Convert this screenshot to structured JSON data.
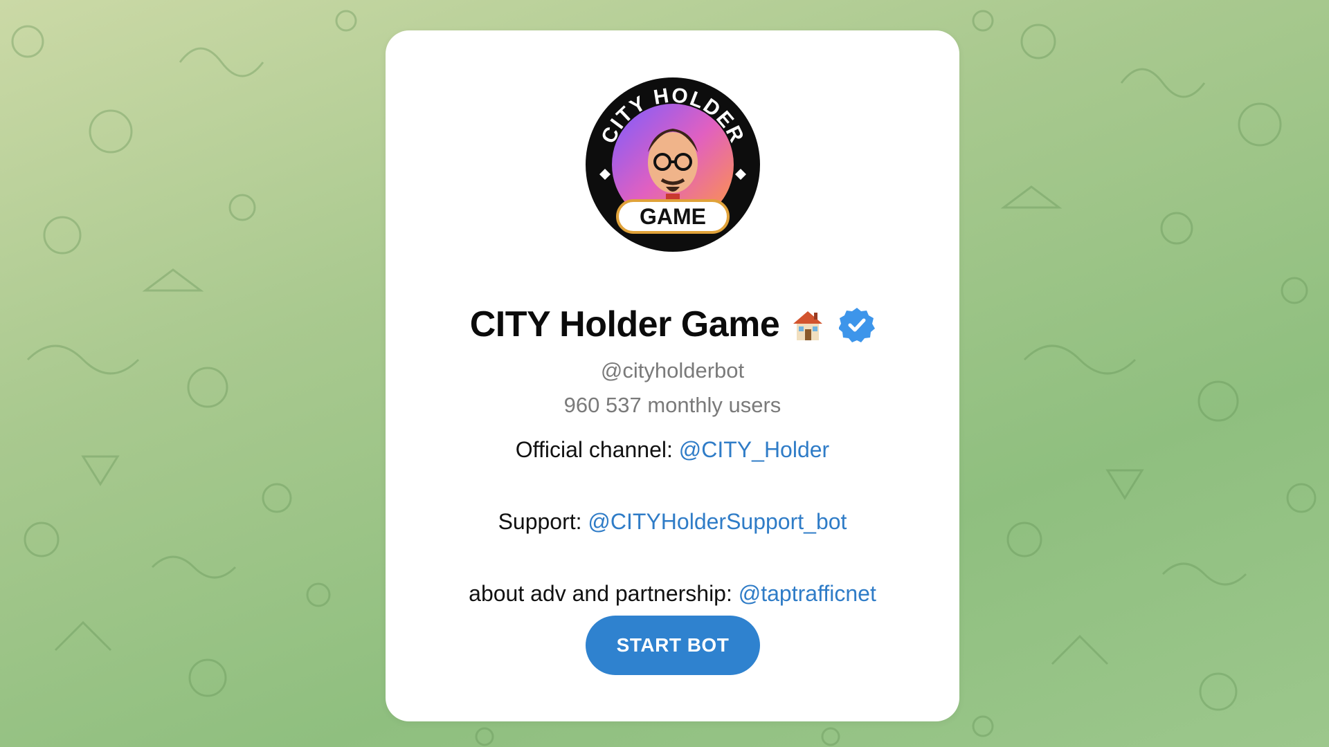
{
  "profile": {
    "title": "CITY Holder Game",
    "username": "@cityholderbot",
    "monthly_users": "960 537 monthly users",
    "avatar": {
      "ring_text": "CITY HOLDER",
      "banner_text": "GAME"
    },
    "icons": {
      "title_emoji": "house-icon",
      "badge": "verified-icon"
    }
  },
  "description": {
    "official_label": "Official channel: ",
    "official_link": "@CITY_Holder",
    "support_label": "Support: ",
    "support_link": "@CITYHolderSupport_bot",
    "adv_label": "about adv and partnership: ",
    "adv_link": "@taptrafficnet"
  },
  "actions": {
    "start_label": "START BOT"
  },
  "colors": {
    "accent": "#2f82cf",
    "link": "#2f7cc7",
    "background_green": "#9cc78c"
  }
}
